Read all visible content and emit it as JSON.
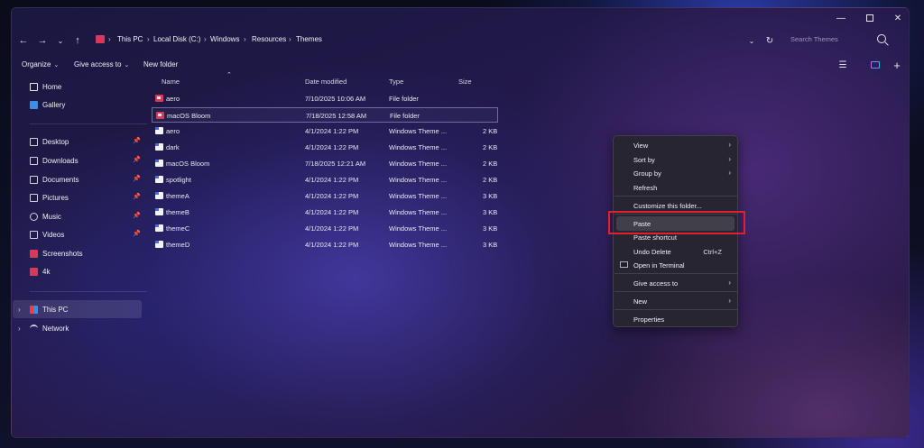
{
  "window": {
    "controls": [
      "minimize",
      "maximize",
      "close"
    ]
  },
  "nav": {
    "breadcrumb": [
      "This PC",
      "Local Disk (C:)",
      "Windows",
      "Resources",
      "Themes"
    ],
    "search_placeholder": "Search Themes"
  },
  "toolbar": {
    "organize": "Organize",
    "give_access": "Give access to",
    "new_folder": "New folder"
  },
  "sidebar": {
    "top": [
      {
        "label": "Home",
        "icon": "home-icon",
        "color": "#e6e6ee"
      },
      {
        "label": "Gallery",
        "icon": "gallery-icon",
        "color": "#3a8ee6"
      }
    ],
    "quick": [
      {
        "label": "Desktop",
        "icon": "desktop-icon",
        "color": "#d0d0e0"
      },
      {
        "label": "Downloads",
        "icon": "downloads-icon",
        "color": "#d0d0e0"
      },
      {
        "label": "Documents",
        "icon": "documents-icon",
        "color": "#d0d0e0"
      },
      {
        "label": "Pictures",
        "icon": "pictures-icon",
        "color": "#d0d0e0"
      },
      {
        "label": "Music",
        "icon": "music-icon",
        "color": "#d0d0e0"
      },
      {
        "label": "Videos",
        "icon": "videos-icon",
        "color": "#d0d0e0"
      },
      {
        "label": "Screenshots",
        "icon": "folder-icon",
        "color": "#d43b5b"
      },
      {
        "label": "4k",
        "icon": "folder-icon",
        "color": "#d43b5b"
      }
    ],
    "tree": [
      {
        "label": "This PC",
        "icon": "this-pc-icon"
      },
      {
        "label": "Network",
        "icon": "network-icon"
      }
    ]
  },
  "columns": {
    "name": "Name",
    "date": "Date modified",
    "type": "Type",
    "size": "Size"
  },
  "files": [
    {
      "name": "aero",
      "date": "7/10/2025 10:06 AM",
      "type": "File folder",
      "size": "",
      "kind": "folder"
    },
    {
      "name": "macOS Bloom",
      "date": "7/18/2025 12:58 AM",
      "type": "File folder",
      "size": "",
      "kind": "folder"
    },
    {
      "name": "aero",
      "date": "4/1/2024 1:22 PM",
      "type": "Windows Theme ...",
      "size": "2 KB",
      "kind": "theme"
    },
    {
      "name": "dark",
      "date": "4/1/2024 1:22 PM",
      "type": "Windows Theme ...",
      "size": "2 KB",
      "kind": "theme"
    },
    {
      "name": "macOS Bloom",
      "date": "7/18/2025 12:21 AM",
      "type": "Windows Theme ...",
      "size": "2 KB",
      "kind": "theme"
    },
    {
      "name": "spotlight",
      "date": "4/1/2024 1:22 PM",
      "type": "Windows Theme ...",
      "size": "2 KB",
      "kind": "theme"
    },
    {
      "name": "themeA",
      "date": "4/1/2024 1:22 PM",
      "type": "Windows Theme ...",
      "size": "3 KB",
      "kind": "theme"
    },
    {
      "name": "themeB",
      "date": "4/1/2024 1:22 PM",
      "type": "Windows Theme ...",
      "size": "3 KB",
      "kind": "theme"
    },
    {
      "name": "themeC",
      "date": "4/1/2024 1:22 PM",
      "type": "Windows Theme ...",
      "size": "3 KB",
      "kind": "theme"
    },
    {
      "name": "themeD",
      "date": "4/1/2024 1:22 PM",
      "type": "Windows Theme ...",
      "size": "3 KB",
      "kind": "theme"
    }
  ],
  "context_menu": {
    "view": "View",
    "sort_by": "Sort by",
    "group_by": "Group by",
    "refresh": "Refresh",
    "customize": "Customize this folder...",
    "paste": "Paste",
    "paste_shortcut": "Paste shortcut",
    "undo_delete": "Undo Delete",
    "undo_shortcut": "Ctrl+Z",
    "open_terminal": "Open in Terminal",
    "give_access": "Give access to",
    "new": "New",
    "properties": "Properties"
  },
  "highlight_color": "#e0202c"
}
